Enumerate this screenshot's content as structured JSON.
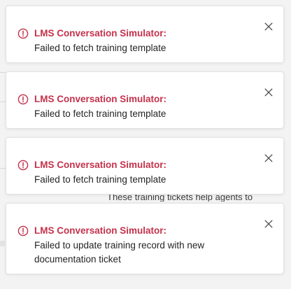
{
  "background": {
    "partial_text": "These training tickets help agents to"
  },
  "icons": {
    "error": "error-circle-icon",
    "close": "close-icon"
  },
  "colors": {
    "error_title": "#c4314b",
    "toast_background": "#ffffff",
    "message_text": "#242424"
  },
  "toasts": [
    {
      "title": "LMS Conversation Simulator:",
      "message": "Failed to fetch training template"
    },
    {
      "title": "LMS Conversation Simulator:",
      "message": "Failed to fetch training template"
    },
    {
      "title": "LMS Conversation Simulator:",
      "message": "Failed to fetch training template"
    },
    {
      "title": "LMS Conversation Simulator:",
      "message": "Failed to update training record with new documentation ticket"
    }
  ]
}
